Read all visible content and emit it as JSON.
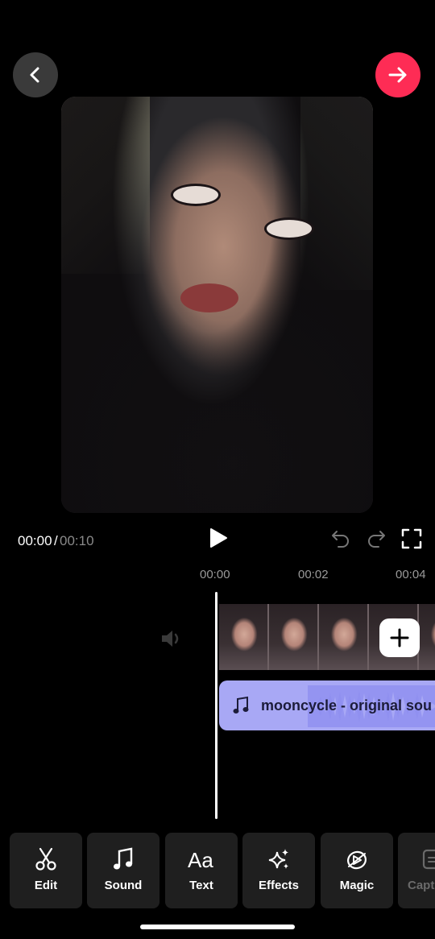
{
  "header": {
    "back_icon": "chevron-left-icon",
    "next_icon": "arrow-right-icon",
    "accent_color": "#fe2c55"
  },
  "playback": {
    "current_time": "00:00",
    "separator": "/",
    "total_time": "00:10",
    "play_icon": "play-icon",
    "undo_icon": "undo-icon",
    "redo_icon": "redo-icon",
    "fullscreen_icon": "fullscreen-icon"
  },
  "timeline": {
    "ticks": [
      "00:00",
      "00:02",
      "00:04"
    ],
    "volume_icon": "speaker-icon",
    "add_clip_icon": "plus-icon",
    "audio_track": {
      "label": "mooncycle - original sou",
      "icon": "music-note-icon",
      "color": "#a8a8f5"
    }
  },
  "toolbar": {
    "tools": [
      {
        "label": "Edit",
        "icon": "scissors-icon"
      },
      {
        "label": "Sound",
        "icon": "music-note-icon"
      },
      {
        "label": "Text",
        "icon": "text-aa-icon"
      },
      {
        "label": "Effects",
        "icon": "sparkles-icon"
      },
      {
        "label": "Magic",
        "icon": "magic-icon"
      },
      {
        "label": "Capt",
        "icon": "captions-icon"
      }
    ]
  }
}
